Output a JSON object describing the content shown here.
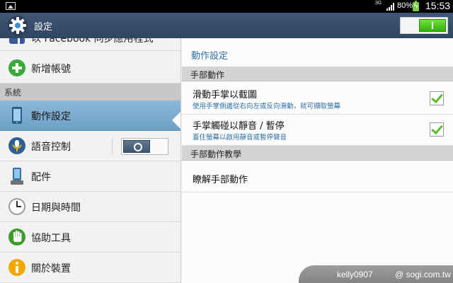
{
  "status_bar": {
    "network": "3G",
    "battery_percent": "80%",
    "time": "15:53",
    "icons": [
      "gallery-icon",
      "signal-icon",
      "battery-charging-icon"
    ]
  },
  "action_bar": {
    "title": "設定",
    "master_switch_on": true,
    "colors": {
      "bar": "#3f5777",
      "switch_on": "#4cc51f"
    }
  },
  "sidebar": {
    "items": [
      {
        "label": "以 Facebook 同步應用程式",
        "icon": "facebook-icon"
      },
      {
        "label": "新增帳號",
        "icon": "add-account-icon"
      }
    ],
    "section_header": "系統",
    "system_items": [
      {
        "label": "動作設定",
        "icon": "motion-icon",
        "selected": true
      },
      {
        "label": "語音控制",
        "icon": "voice-control-icon",
        "toggle_on": false
      },
      {
        "label": "配件",
        "icon": "accessory-icon"
      },
      {
        "label": "日期與時間",
        "icon": "clock-icon"
      },
      {
        "label": "協助工具",
        "icon": "accessibility-hand-icon"
      },
      {
        "label": "關於裝置",
        "icon": "info-icon"
      }
    ]
  },
  "detail": {
    "title": "動作設定",
    "sections": [
      {
        "header": "手部動作",
        "items": [
          {
            "title": "滑動手掌以截圖",
            "summary": "使用手掌側邊從右向左或反向滑動，就可擷取螢幕",
            "checked": true
          },
          {
            "title": "手掌觸碰以靜音 / 暫停",
            "summary": "蓋住螢幕以啟用靜音或暫停聲音",
            "checked": true
          }
        ]
      },
      {
        "header": "手部動作教學",
        "items": [
          {
            "title": "瞭解手部動作"
          }
        ]
      }
    ],
    "accent": "#2f6fa3"
  },
  "watermark": {
    "user": "kelly0907",
    "site": "@ sogi.com.tw"
  }
}
